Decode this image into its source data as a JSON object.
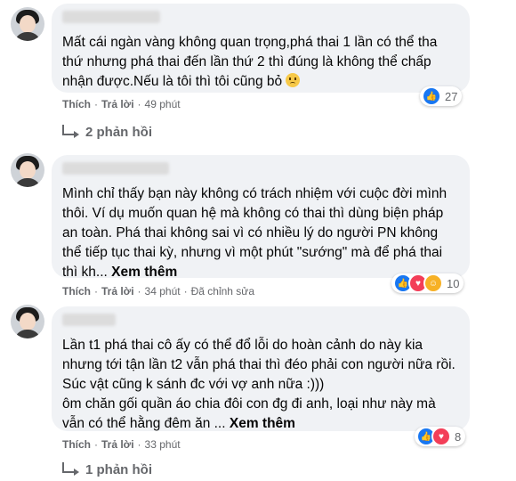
{
  "comments": [
    {
      "author": "Lê Hạnh",
      "text": "Mất cái ngàn vàng không quan trọng,phá thai 1 lần có thể tha thứ nhưng phá thai đến lần thứ 2 thì đúng là không thể chấp nhận được.Nếu là tôi thì tôi cũng bỏ",
      "reaction_count": "27",
      "like_label": "Thích",
      "reply_label": "Trả lời",
      "time": "49 phút",
      "replies": "2 phản hồi"
    },
    {
      "author": "Thương Phan",
      "text": "Mình chỉ thấy bạn này không có trách nhiệm với cuộc đời mình thôi. Ví dụ muốn quan hệ mà không có thai thì dùng biện pháp an toàn. Phá thai không sai vì có nhiều lý do người PN không thể tiếp tục thai kỳ, nhưng vì một phút \"sướng\" mà để phá thai thì kh...",
      "see_more": "Xem thêm",
      "reaction_count": "10",
      "like_label": "Thích",
      "reply_label": "Trả lời",
      "time": "34 phút",
      "edited": "Đã chỉnh sửa"
    },
    {
      "author": "Ni Ly",
      "text": "Lần t1 phá thai cô ấy có thể đổ lỗi do hoàn cảnh do này kia nhưng tới tận lần t2 vẫn phá thai thì đéo phải con người nữa rồi. Súc vật cũng k sánh đc với vợ anh nữa :)))\nôm chăn gối quần áo chia đôi con đg đi anh, loại như này mà vẫn có thể hằng đêm ăn ...",
      "see_more": "Xem thêm",
      "reaction_count": "8",
      "like_label": "Thích",
      "reply_label": "Trả lời",
      "time": "33 phút",
      "replies": "1 phản hồi"
    }
  ]
}
